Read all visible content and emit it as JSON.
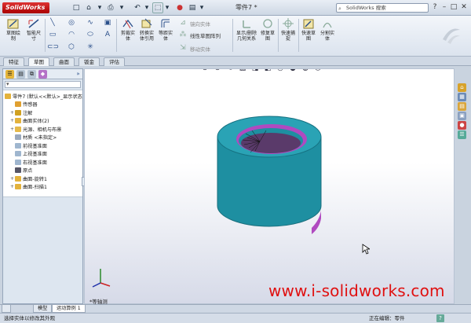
{
  "app": {
    "logo": "SolidWorks",
    "document_title": "零件7 *"
  },
  "quick_access": [
    "□",
    "⌂",
    "▾",
    "⎙",
    "▾",
    "↶",
    "▾",
    "⬚",
    "▾",
    "●",
    "▤",
    "▾"
  ],
  "search": {
    "placeholder": "SolidWorks 搜索"
  },
  "window_controls": {
    "help": "?",
    "minimize": "–",
    "restore": "□",
    "close": "✕"
  },
  "ribbon": {
    "sketch_label": "草图绘制",
    "smart_dim_label": "智能尺寸",
    "trim_label": "剪裁实体",
    "convert_label": "转换实体引用",
    "offset_label": "等距实体",
    "mirror_label": "镜向实体",
    "linear_pattern_label": "线性草图阵列",
    "move_label": "移动实体",
    "display_relations_label": "显示/删除几何关系",
    "repair_label": "修复草图",
    "quick_snaps_label": "快速捕捉",
    "rapid_sketch_label": "快速草图",
    "split_label": "分割实体"
  },
  "command_tabs": [
    "特征",
    "草图",
    "曲面",
    "钣金",
    "评估"
  ],
  "feature_manager": {
    "root": "零件7 (默认<<默认>_显示状态",
    "items": [
      {
        "label": "传感器",
        "expand": "",
        "color": "#e0a030"
      },
      {
        "label": "注解",
        "expand": "+",
        "color": "#d0a020"
      },
      {
        "label": "曲面实体(2)",
        "expand": "+",
        "color": "#e3b23c"
      },
      {
        "label": "光源、相机与布景",
        "expand": "+",
        "color": "#e5b94a"
      },
      {
        "label": "材质 <未指定>",
        "expand": "",
        "color": "#9aa9bd"
      },
      {
        "label": "前视基准面",
        "expand": "",
        "color": "#9fb6cf"
      },
      {
        "label": "上视基准面",
        "expand": "",
        "color": "#9fb6cf"
      },
      {
        "label": "右视基准面",
        "expand": "",
        "color": "#9fb6cf"
      },
      {
        "label": "原点",
        "expand": "",
        "color": "#556"
      },
      {
        "label": "曲面-旋转1",
        "expand": "+",
        "color": "#e3b23c"
      },
      {
        "label": "曲面-扫描1",
        "expand": "+",
        "color": "#e3b23c"
      }
    ]
  },
  "viewport": {
    "view_name": "*等轴测",
    "watermark": "www.i-solidworks.com",
    "model_color": "#1e8fa1",
    "inner_color": "#b04ac0"
  },
  "bottom_tabs": [
    "模型",
    "运动算例 1"
  ],
  "status": {
    "message": "选择实体以修改其外观",
    "editing": "正在编辑：零件",
    "help": "?"
  }
}
